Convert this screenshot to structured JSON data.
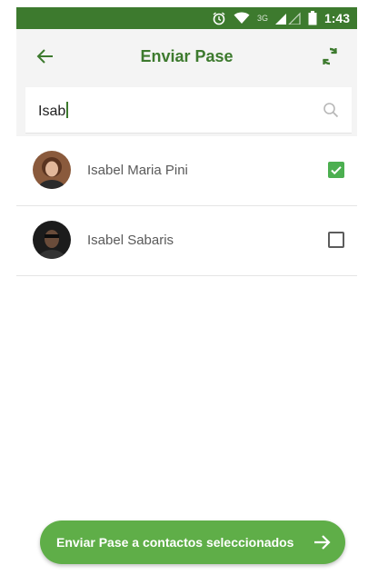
{
  "status_bar": {
    "time": "1:43",
    "network": "3G"
  },
  "header": {
    "title": "Enviar Pase"
  },
  "search": {
    "value": "Isab"
  },
  "contacts": [
    {
      "name": "Isabel Maria Pini",
      "selected": true
    },
    {
      "name": "Isabel Sabaris",
      "selected": false
    }
  ],
  "action": {
    "label": "Enviar Pase a contactos seleccionados"
  },
  "icons": {
    "back": "arrow-left-icon",
    "sync": "sync-icon",
    "search": "search-icon",
    "send": "arrow-right-icon",
    "alarm": "alarm-icon",
    "wifi": "wifi-icon",
    "signal": "signal-icon",
    "battery": "battery-icon"
  },
  "colors": {
    "primary": "#3d7a2e",
    "accent": "#5fae48",
    "check": "#4caf50"
  }
}
